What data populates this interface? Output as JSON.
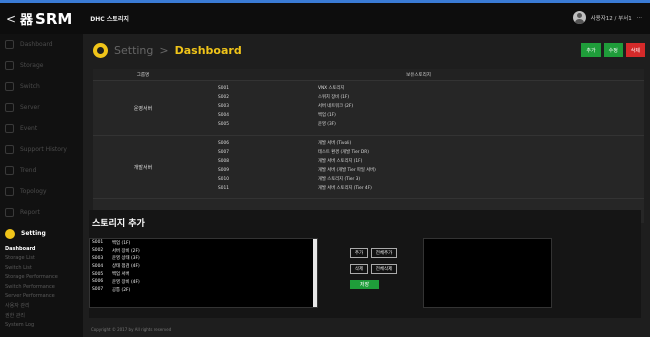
{
  "header": {
    "back_glyph": "<",
    "logo_mark": "器",
    "logo_text": "SRM",
    "breadcrumb": "DHC 스토리지",
    "user_name": "사용자12 / 부서1",
    "menu_glyph": "···"
  },
  "sidebar": {
    "items": [
      {
        "label": "Dashboard",
        "icon": "dashboard-icon"
      },
      {
        "label": "Storage",
        "icon": "storage-icon"
      },
      {
        "label": "Switch",
        "icon": "switch-icon"
      },
      {
        "label": "Server",
        "icon": "server-icon"
      },
      {
        "label": "Event",
        "icon": "event-icon"
      },
      {
        "label": "Support History",
        "icon": "support-icon"
      },
      {
        "label": "Trend",
        "icon": "trend-icon"
      },
      {
        "label": "Topology",
        "icon": "topology-icon"
      },
      {
        "label": "Report",
        "icon": "report-icon"
      },
      {
        "label": "Setting",
        "icon": "gear-icon"
      }
    ],
    "sub_items": [
      "Dashboard",
      "Storage List",
      "Switch List",
      "Storage Performance",
      "Switch Performance",
      "Server Performance",
      "사용자 관리",
      "권한 관리",
      "System Log"
    ]
  },
  "main": {
    "title_parent": "Setting",
    "title_sep": ">",
    "title_current": "Dashboard",
    "buttons": {
      "add": "추가",
      "edit": "수정",
      "delete": "삭제"
    },
    "columns": {
      "group": "그룹명",
      "items": "보유스토리지"
    },
    "groups": [
      {
        "label": "운영서버",
        "rows": [
          {
            "code": "S001",
            "name": "VNX 스토리지"
          },
          {
            "code": "S002",
            "name": "스위치 장비 (1F)"
          },
          {
            "code": "S003",
            "name": "서버 네트워크 (2F)"
          },
          {
            "code": "S004",
            "name": "백업 (1F)"
          },
          {
            "code": "S005",
            "name": "운영 (3F)"
          }
        ]
      },
      {
        "label": "개발서버",
        "rows": [
          {
            "code": "S006",
            "name": "개발 서버 (Tivoli)"
          },
          {
            "code": "S007",
            "name": "테스트 환경 (개발 Tier DR)"
          },
          {
            "code": "S008",
            "name": "개발 서버 스토리지 (1F)"
          },
          {
            "code": "S009",
            "name": "개발 서버 (개발 Tier 파일 서버)"
          },
          {
            "code": "S010",
            "name": "개발 스토리지 (Tier 3)"
          },
          {
            "code": "S011",
            "name": "개발 서버 스토리지 (Tier 4F)"
          }
        ]
      }
    ],
    "panel": {
      "title": "스토리지 추가",
      "list": [
        {
          "code": "S001",
          "name": "백업 (1F)"
        },
        {
          "code": "S002",
          "name": "서버 장비 (2F)"
        },
        {
          "code": "S003",
          "name": "운영 상태 (3F)"
        },
        {
          "code": "S004",
          "name": "상태 점검 (4F)"
        },
        {
          "code": "S005",
          "name": "백업 서버"
        },
        {
          "code": "S006",
          "name": "운영 장비 (4F)"
        },
        {
          "code": "S007",
          "name": "공통 (2F)"
        }
      ],
      "btn_add": "추가",
      "btn_add_all": "전체추가",
      "btn_remove": "삭제",
      "btn_remove_all": "전체삭제",
      "btn_save": "저장"
    },
    "copyright": "Copyright © 2017 by All rights reserved"
  },
  "colors": {
    "accent": "#f0c419",
    "action_green": "#1f9d3a",
    "delete_red": "#d52a2a",
    "top_strip": "#3a7bd5"
  }
}
